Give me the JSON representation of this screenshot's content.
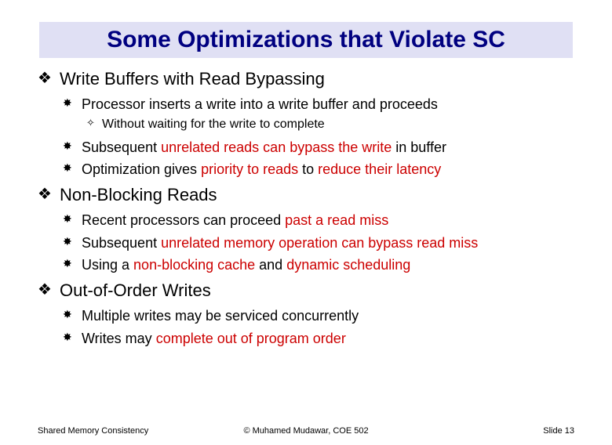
{
  "title": "Some Optimizations that Violate SC",
  "sections": [
    {
      "heading": "Write Buffers with Read Bypassing",
      "items": [
        {
          "runs": [
            {
              "text": "Processor inserts a write into a write buffer and proceeds",
              "red": false
            }
          ],
          "sub": [
            {
              "runs": [
                {
                  "text": "Without waiting for the write to complete",
                  "red": false
                }
              ]
            }
          ]
        },
        {
          "runs": [
            {
              "text": "Subsequent ",
              "red": false
            },
            {
              "text": "unrelated reads can bypass the write",
              "red": true
            },
            {
              "text": " in buffer",
              "red": false
            }
          ]
        },
        {
          "runs": [
            {
              "text": "Optimization gives ",
              "red": false
            },
            {
              "text": "priority to reads",
              "red": true
            },
            {
              "text": " to ",
              "red": false
            },
            {
              "text": "reduce their latency",
              "red": true
            }
          ]
        }
      ]
    },
    {
      "heading": "Non-Blocking Reads",
      "items": [
        {
          "runs": [
            {
              "text": "Recent processors can proceed ",
              "red": false
            },
            {
              "text": "past a read miss",
              "red": true
            }
          ]
        },
        {
          "runs": [
            {
              "text": "Subsequent ",
              "red": false
            },
            {
              "text": "unrelated memory operation can bypass read miss",
              "red": true
            }
          ]
        },
        {
          "runs": [
            {
              "text": "Using a ",
              "red": false
            },
            {
              "text": "non-blocking cache",
              "red": true
            },
            {
              "text": " and ",
              "red": false
            },
            {
              "text": "dynamic scheduling",
              "red": true
            }
          ]
        }
      ]
    },
    {
      "heading": "Out-of-Order Writes",
      "items": [
        {
          "runs": [
            {
              "text": "Multiple writes may be serviced concurrently",
              "red": false
            }
          ]
        },
        {
          "runs": [
            {
              "text": "Writes may ",
              "red": false
            },
            {
              "text": "complete out of program order",
              "red": true
            }
          ]
        }
      ]
    }
  ],
  "footer": {
    "left": "Shared Memory Consistency",
    "center": "© Muhamed Mudawar, COE 502",
    "right": "Slide 13"
  }
}
